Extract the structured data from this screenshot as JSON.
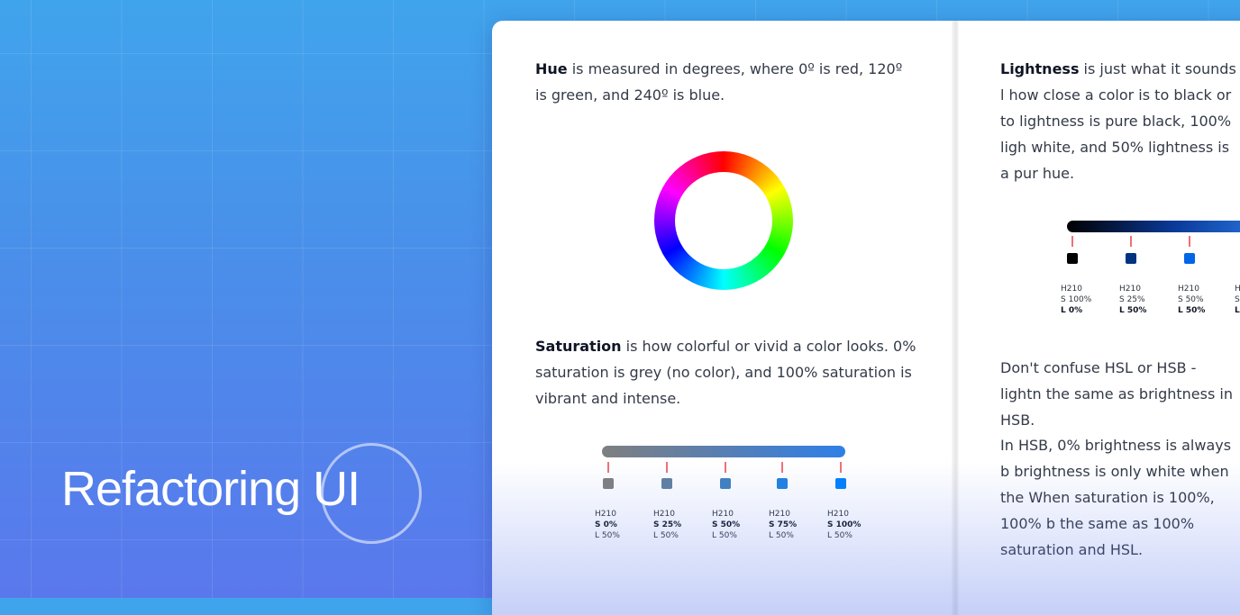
{
  "brand": {
    "name": "Refactoring UI"
  },
  "left_page": {
    "hue": {
      "term": "Hue",
      "text": " is measured in degrees, where 0º is red, 120º is green, and 240º is blue."
    },
    "saturation": {
      "term": "Saturation",
      "text": " is how colorful or vivid a color looks. 0% saturation is grey (no color), and 100% saturation is vibrant and intense."
    },
    "swatches": [
      {
        "h": "H210",
        "s": "S 0%",
        "l": "L 50%",
        "color": "#7f7f7f"
      },
      {
        "h": "H210",
        "s": "S 25%",
        "l": "L 50%",
        "color": "#6080a0"
      },
      {
        "h": "H210",
        "s": "S 50%",
        "l": "L 50%",
        "color": "#4080bf"
      },
      {
        "h": "H210",
        "s": "S 75%",
        "l": "L 50%",
        "color": "#2080df"
      },
      {
        "h": "H210",
        "s": "S 100%",
        "l": "L 50%",
        "color": "#0080ff"
      }
    ]
  },
  "right_page": {
    "lightness": {
      "term": "Lightness",
      "text": " is just what it sounds l how close a color is to black or to lightness is pure black, 100% ligh white, and 50% lightness is a pur hue."
    },
    "swatches": [
      {
        "h": "H210",
        "s": "S 100%",
        "l": "L 0%",
        "color": "#000000"
      },
      {
        "h": "H210",
        "s": "S 25%",
        "l": "L 50%",
        "color": "#003380"
      },
      {
        "h": "H210",
        "s": "S 50%",
        "l": "L 50%",
        "color": "#0066e6"
      },
      {
        "h": "H",
        "s": "S",
        "l": "L",
        "color": "#ffffff"
      }
    ],
    "confuse": "Don't confuse HSL or HSB - lightn the same as brightness in HSB.",
    "hsb": "In HSB, 0% brightness is always b brightness is only white when the When saturation is 100%, 100% b the same as 100% saturation and HSL."
  }
}
